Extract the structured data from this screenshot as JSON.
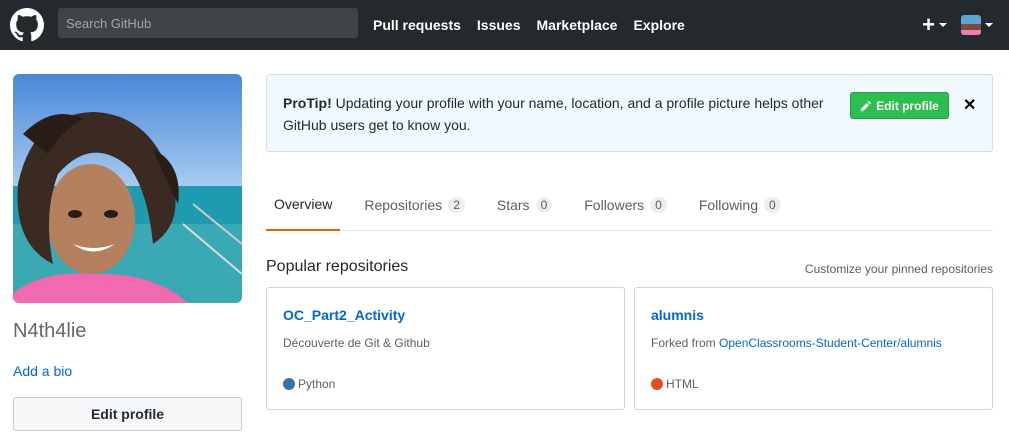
{
  "header": {
    "search_placeholder": "Search GitHub",
    "nav": [
      "Pull requests",
      "Issues",
      "Marketplace",
      "Explore"
    ],
    "plus_icon": "+"
  },
  "profile": {
    "username": "N4th4lie",
    "add_bio": "Add a bio",
    "edit_profile": "Edit profile"
  },
  "protip": {
    "label": "ProTip!",
    "text": " Updating your profile with your name, location, and a profile picture helps other GitHub users get to know you.",
    "edit_label": "Edit profile",
    "close": "✕"
  },
  "tabs": [
    {
      "label": "Overview",
      "count": null
    },
    {
      "label": "Repositories",
      "count": "2"
    },
    {
      "label": "Stars",
      "count": "0"
    },
    {
      "label": "Followers",
      "count": "0"
    },
    {
      "label": "Following",
      "count": "0"
    }
  ],
  "popular": {
    "title": "Popular repositories",
    "customize": "Customize your pinned repositories",
    "repos": [
      {
        "name": "OC_Part2_Activity",
        "desc": "Découverte de Git & Github",
        "forked_prefix": "",
        "forked_link": "",
        "language": "Python",
        "lang_color": "#3572A5"
      },
      {
        "name": "alumnis",
        "desc": "",
        "forked_prefix": "Forked from ",
        "forked_link": "OpenClassrooms-Student-Center/alumnis",
        "language": "HTML",
        "lang_color": "#e34c26"
      }
    ]
  },
  "colors": {
    "header_bg": "#24292e",
    "accent": "#e36209",
    "green": "#2cbe4e",
    "link": "#0366d6"
  }
}
